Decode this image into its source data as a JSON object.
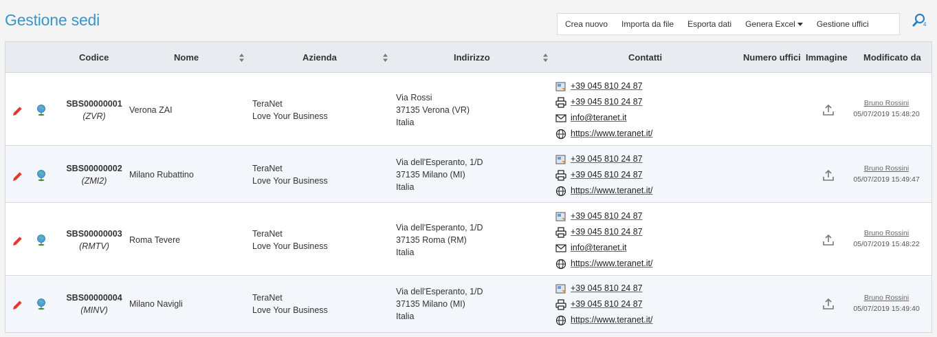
{
  "page": {
    "title": "Gestione sedi"
  },
  "toolbar": {
    "crea": "Crea nuovo",
    "importa": "Importa da file",
    "esporta": "Esporta dati",
    "genera": "Genera Excel",
    "gestione": "Gestione uffici",
    "search_badge": "4"
  },
  "columns": {
    "codice": "Codice",
    "nome": "Nome",
    "azienda": "Azienda",
    "indirizzo": "Indirizzo",
    "contatti": "Contatti",
    "numero_uffici": "Numero uffici",
    "immagine": "Immagine",
    "modificato_da": "Modificato da"
  },
  "rows": [
    {
      "code": "SBS00000001",
      "abbr": "ZVR",
      "name": "Verona ZAI",
      "company1": "TeraNet",
      "company2": "Love Your Business",
      "addr1": "Via Rossi",
      "addr2": "37135 Verona (VR)",
      "addr3": "Italia",
      "phone": "+39 045 810 24 87",
      "fax": "+39 045 810 24 87",
      "email": "info@teranet.it",
      "web": "https://www.teranet.it/",
      "user": "Bruno Rossini",
      "date": "05/07/2019 15:48:20"
    },
    {
      "code": "SBS00000002",
      "abbr": "ZMI2",
      "name": "Milano Rubattino",
      "company1": "TeraNet",
      "company2": "Love Your Business",
      "addr1": "Via dell'Esperanto, 1/D",
      "addr2": "37135 Milano (MI)",
      "addr3": "Italia",
      "phone": "+39 045 810 24 87",
      "fax": "+39 045 810 24 87",
      "web": "https://www.teranet.it/",
      "user": "Bruno Rossini",
      "date": "05/07/2019 15:49:47"
    },
    {
      "code": "SBS00000003",
      "abbr": "RMTV",
      "name": "Roma Tevere",
      "company1": "TeraNet",
      "company2": "Love Your Business",
      "addr1": "Via dell'Esperanto, 1/D",
      "addr2": "37135 Roma (RM)",
      "addr3": "Italia",
      "phone": "+39 045 810 24 87",
      "fax": "+39 045 810 24 87",
      "email": "info@teranet.it",
      "web": "https://www.teranet.it/",
      "user": "Bruno Rossini",
      "date": "05/07/2019 15:48:22"
    },
    {
      "code": "SBS00000004",
      "abbr": "MINV",
      "name": "Milano Navigli",
      "company1": "TeraNet",
      "company2": "Love Your Business",
      "addr1": "Via dell'Esperanto, 1/D",
      "addr2": "37135 Milano (MI)",
      "addr3": "Italia",
      "phone": "+39 045 810 24 87",
      "fax": "+39 045 810 24 87",
      "web": "https://www.teranet.it/",
      "user": "Bruno Rossini",
      "date": "05/07/2019 15:49:40"
    }
  ],
  "icons": {
    "edit": "pencil-icon",
    "map": "globe-pin-icon",
    "phone": "phone-icon",
    "fax": "fax-icon",
    "email": "envelope-icon",
    "web": "globe-icon",
    "upload": "upload-icon",
    "search": "search-icon"
  },
  "colors": {
    "title": "#3a95c6",
    "edit": "#e03a2f",
    "header_bg": "#e8ebef",
    "alt_row": "#f3f6fa"
  }
}
